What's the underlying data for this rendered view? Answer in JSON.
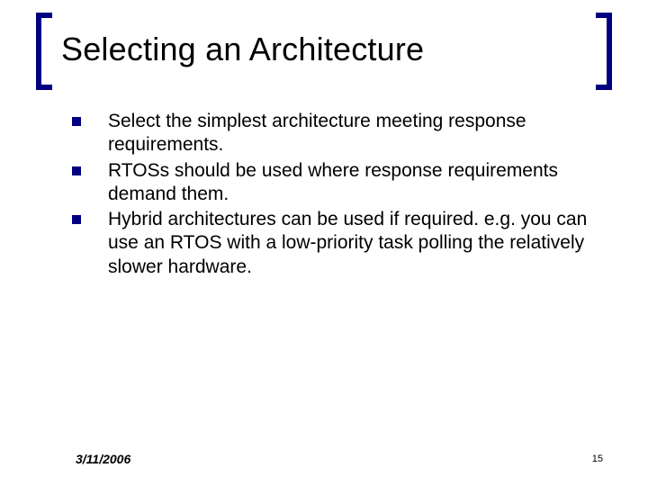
{
  "title": "Selecting an Architecture",
  "bullets": [
    "Select the simplest architecture meeting response requirements.",
    "RTOSs should be used where response requirements demand them.",
    "Hybrid architectures can be used if required. e.g. you can use an RTOS with a low-priority task polling the relatively slower hardware."
  ],
  "footer": {
    "date": "3/11/2006",
    "page": "15"
  }
}
